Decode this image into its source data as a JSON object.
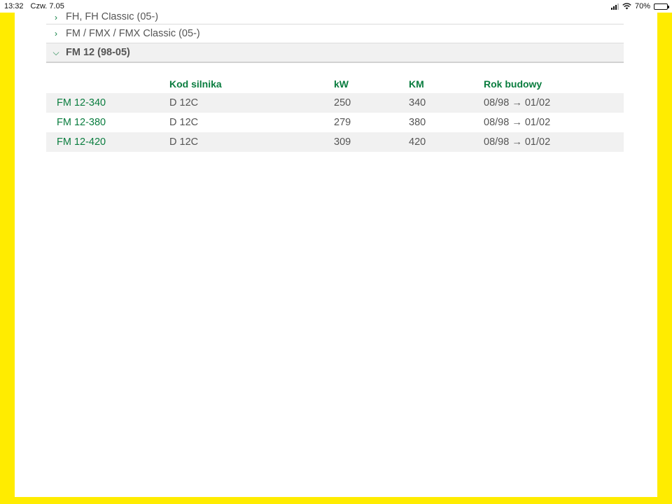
{
  "status_bar": {
    "time": "13:32",
    "date": "Czw. 7.05",
    "battery_percent": "70%",
    "battery_level": 0.7,
    "icons": [
      "signal-icon",
      "wifi-icon",
      "battery-icon"
    ]
  },
  "accordion": {
    "items": [
      {
        "label": "FH, FH Classic (05-)",
        "expanded": false
      },
      {
        "label": "FM / FMX / FMX Classic (05-)",
        "expanded": false
      },
      {
        "label": "FM 12 (98-05)",
        "expanded": true
      }
    ]
  },
  "table": {
    "headers": [
      "",
      "Kod silnika",
      "kW",
      "KM",
      "Rok budowy"
    ],
    "rows": [
      {
        "model": "FM 12-340",
        "engine": "D 12C",
        "kw": "250",
        "km": "340",
        "years": "08/98 → 01/02"
      },
      {
        "model": "FM 12-380",
        "engine": "D 12C",
        "kw": "279",
        "km": "380",
        "years": "08/98 → 01/02"
      },
      {
        "model": "FM 12-420",
        "engine": "D 12C",
        "kw": "309",
        "km": "420",
        "years": "08/98 → 01/02"
      }
    ]
  },
  "colors": {
    "accent_green": "#0a7d3f",
    "frame_yellow": "#ffec00",
    "row_stripe": "#f1f1f1"
  }
}
